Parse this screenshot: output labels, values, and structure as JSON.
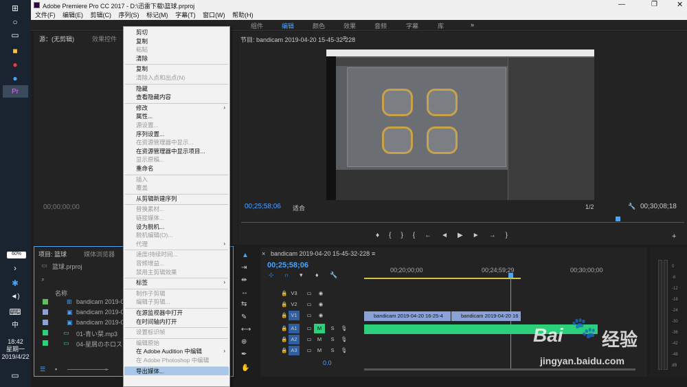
{
  "window": {
    "title": "Adobe Premiere Pro CC 2017 - D:\\迅雷下载\\篮球.prproj"
  },
  "menubar": [
    "文件(F)",
    "编辑(E)",
    "剪辑(C)",
    "序列(S)",
    "标记(M)",
    "字幕(T)",
    "窗口(W)",
    "帮助(H)"
  ],
  "workspaces": [
    "组件",
    "编辑",
    "颜色",
    "效果",
    "音频",
    "字幕",
    "库"
  ],
  "workspace_more": "»",
  "source_panel": {
    "tab1": "源：(无剪辑)",
    "tab2": "效果控件",
    "timecode": "00;00;00;00"
  },
  "program": {
    "title": "节目: bandicam 2019-04-20 15-45-32-228",
    "timecode": "00;25;58;06",
    "fit": "适合",
    "ratio": "1/2",
    "end_timecode": "00;30;08;18"
  },
  "project": {
    "tab1": "项目: 篮球",
    "tab2": "媒体浏览器",
    "file": "篮球.prproj",
    "col_name": "名称",
    "items": [
      "bandicam 2019-04-20",
      "bandicam 2019-04-20",
      "bandicam 2019-04-20",
      "01-青い栞.mp3",
      "04-星屑のホロスコー"
    ]
  },
  "timeline": {
    "title": "bandicam 2019-04-20 15-45-32-228",
    "timecode": "00;25;58;06",
    "ruler": [
      "00;20;00;00",
      "00;24;59;29",
      "00;30;00;00"
    ],
    "tracks": [
      "V3",
      "V2",
      "V1",
      "A1",
      "A2",
      "A3"
    ],
    "clip1": "bandicam 2019-04-20 16-25-4",
    "clip2": "bandicam 2019-04-20 16",
    "mix": "0.0",
    "m_label": "M",
    "s_label": "S"
  },
  "context_menu": [
    {
      "label": "剪切",
      "disabled": false
    },
    {
      "label": "复制",
      "disabled": false
    },
    {
      "label": "粘贴",
      "disabled": true
    },
    {
      "label": "清除",
      "disabled": false
    },
    {
      "label": "复制",
      "disabled": false
    },
    {
      "label": "清除入点和出点(N)",
      "disabled": true
    },
    {
      "label": "隐藏",
      "disabled": false
    },
    {
      "label": "查看隐藏内容",
      "disabled": false
    },
    {
      "label": "修改",
      "disabled": false,
      "sub": true
    },
    {
      "label": "属性...",
      "disabled": false
    },
    {
      "label": "源设置...",
      "disabled": true
    },
    {
      "label": "序列设置...",
      "disabled": false
    },
    {
      "label": "在资源管理器中显示...",
      "disabled": true
    },
    {
      "label": "在资源管理器中显示项目...",
      "disabled": false
    },
    {
      "label": "显示原稿...",
      "disabled": true
    },
    {
      "label": "重命名",
      "disabled": false
    },
    {
      "label": "插入",
      "disabled": true
    },
    {
      "label": "覆盖",
      "disabled": true
    },
    {
      "label": "从剪辑新建序列",
      "disabled": false
    },
    {
      "label": "替换素材...",
      "disabled": true
    },
    {
      "label": "链接媒体...",
      "disabled": true
    },
    {
      "label": "设为脱机...",
      "disabled": false
    },
    {
      "label": "脱机编辑(O)...",
      "disabled": true
    },
    {
      "label": "代理",
      "disabled": true,
      "sub": true
    },
    {
      "label": "速度/持续时间...",
      "disabled": true
    },
    {
      "label": "音频增益...",
      "disabled": true
    },
    {
      "label": "禁用主剪辑效果",
      "disabled": true
    },
    {
      "label": "标签",
      "disabled": false,
      "sub": true
    },
    {
      "label": "制作子剪辑",
      "disabled": true
    },
    {
      "label": "编辑子剪辑...",
      "disabled": true
    },
    {
      "label": "在源监视器中打开",
      "disabled": false
    },
    {
      "label": "在时间轴内打开",
      "disabled": false
    },
    {
      "label": "设置标识帧",
      "disabled": true
    },
    {
      "label": "编辑原始",
      "disabled": true
    },
    {
      "label": "在 Adobe Audition 中编辑",
      "disabled": false,
      "sub": true
    },
    {
      "label": "在 Adobe Photoshop 中编辑",
      "disabled": true
    },
    {
      "label": "导出媒体...",
      "disabled": false,
      "highlight": true
    }
  ],
  "clock": {
    "time": "18:42",
    "day": "星期一",
    "date": "2019/4/22",
    "battery": "60%",
    "ime": "中"
  },
  "watermark": {
    "brand": "Bai",
    "brand2": "经验",
    "url": "jingyan.baidu.com"
  },
  "meter_labels": [
    "0",
    "-6",
    "-12",
    "-18",
    "-24",
    "-30",
    "-36",
    "-42",
    "-48",
    "dB"
  ]
}
